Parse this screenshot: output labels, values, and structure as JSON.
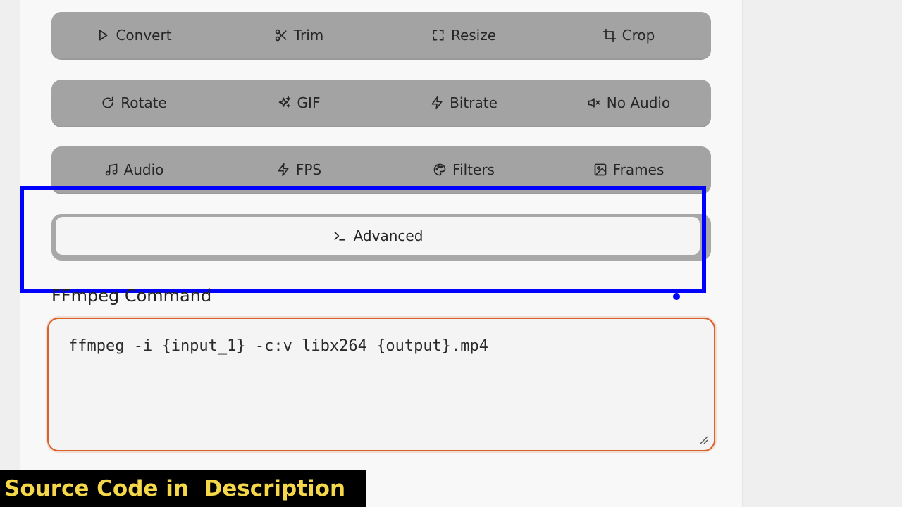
{
  "operations": {
    "row1": [
      {
        "label": "Convert",
        "icon": "play-icon"
      },
      {
        "label": "Trim",
        "icon": "scissors-icon"
      },
      {
        "label": "Resize",
        "icon": "resize-frame-icon"
      },
      {
        "label": "Crop",
        "icon": "crop-icon"
      }
    ],
    "row2": [
      {
        "label": "Rotate",
        "icon": "rotate-icon"
      },
      {
        "label": "GIF",
        "icon": "sparkles-icon"
      },
      {
        "label": "Bitrate",
        "icon": "lightning-icon"
      },
      {
        "label": "No Audio",
        "icon": "volume-mute-icon"
      }
    ],
    "row3": [
      {
        "label": "Audio",
        "icon": "music-note-icon"
      },
      {
        "label": "FPS",
        "icon": "lightning-icon"
      },
      {
        "label": "Filters",
        "icon": "palette-icon"
      },
      {
        "label": "Frames",
        "icon": "image-icon"
      }
    ]
  },
  "advanced": {
    "label": "Advanced",
    "icon": "terminal-icon"
  },
  "command": {
    "label": "FFmpeg Command",
    "value": "ffmpeg -i {input_1} -c:v libx264 {output}.mp4"
  },
  "banner": {
    "text": "Source Code in  Description"
  },
  "colors": {
    "highlight": "#0000ff",
    "command_border": "#d9622b",
    "banner_text": "#f5d84a",
    "button_bg": "#a3a3a3"
  }
}
